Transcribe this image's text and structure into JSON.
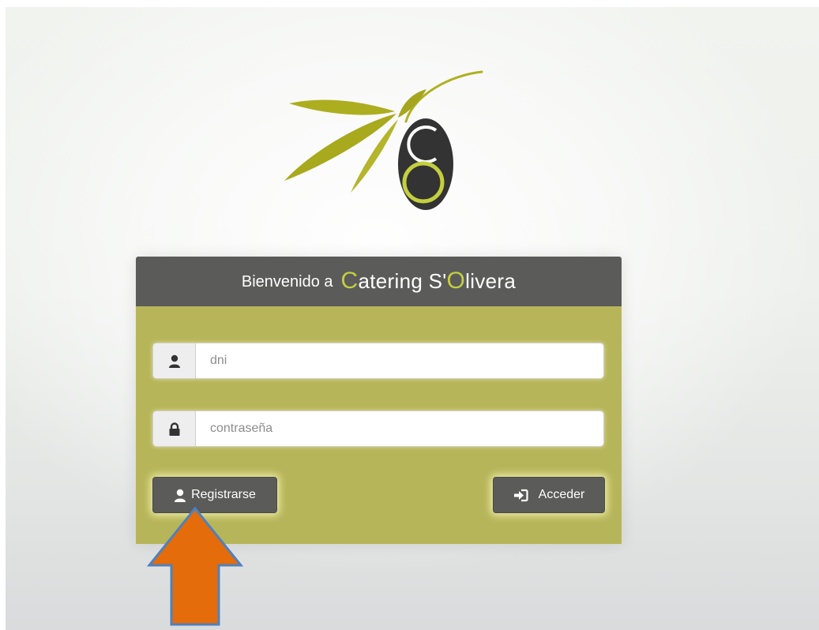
{
  "header": {
    "welcome": "Bienvenido a",
    "brand_initial_1": "C",
    "brand_rest_1": "atering S'",
    "brand_initial_2": "O",
    "brand_rest_2": "livera"
  },
  "form": {
    "dni_placeholder": "dni",
    "password_placeholder": "contraseña"
  },
  "buttons": {
    "register_label": "Registrarse",
    "login_label": "Acceder"
  },
  "icons": {
    "dni": "user-icon",
    "password": "lock-icon",
    "register": "user-icon",
    "login": "sign-in-icon"
  },
  "colors": {
    "header_bg": "#5b5b5a",
    "card_body": "#b7b55a",
    "brand_accent": "#c3cf3f",
    "olive_leaf": "#adae1f",
    "arrow_fill": "#e46c0a",
    "arrow_stroke": "#4f81bd"
  }
}
